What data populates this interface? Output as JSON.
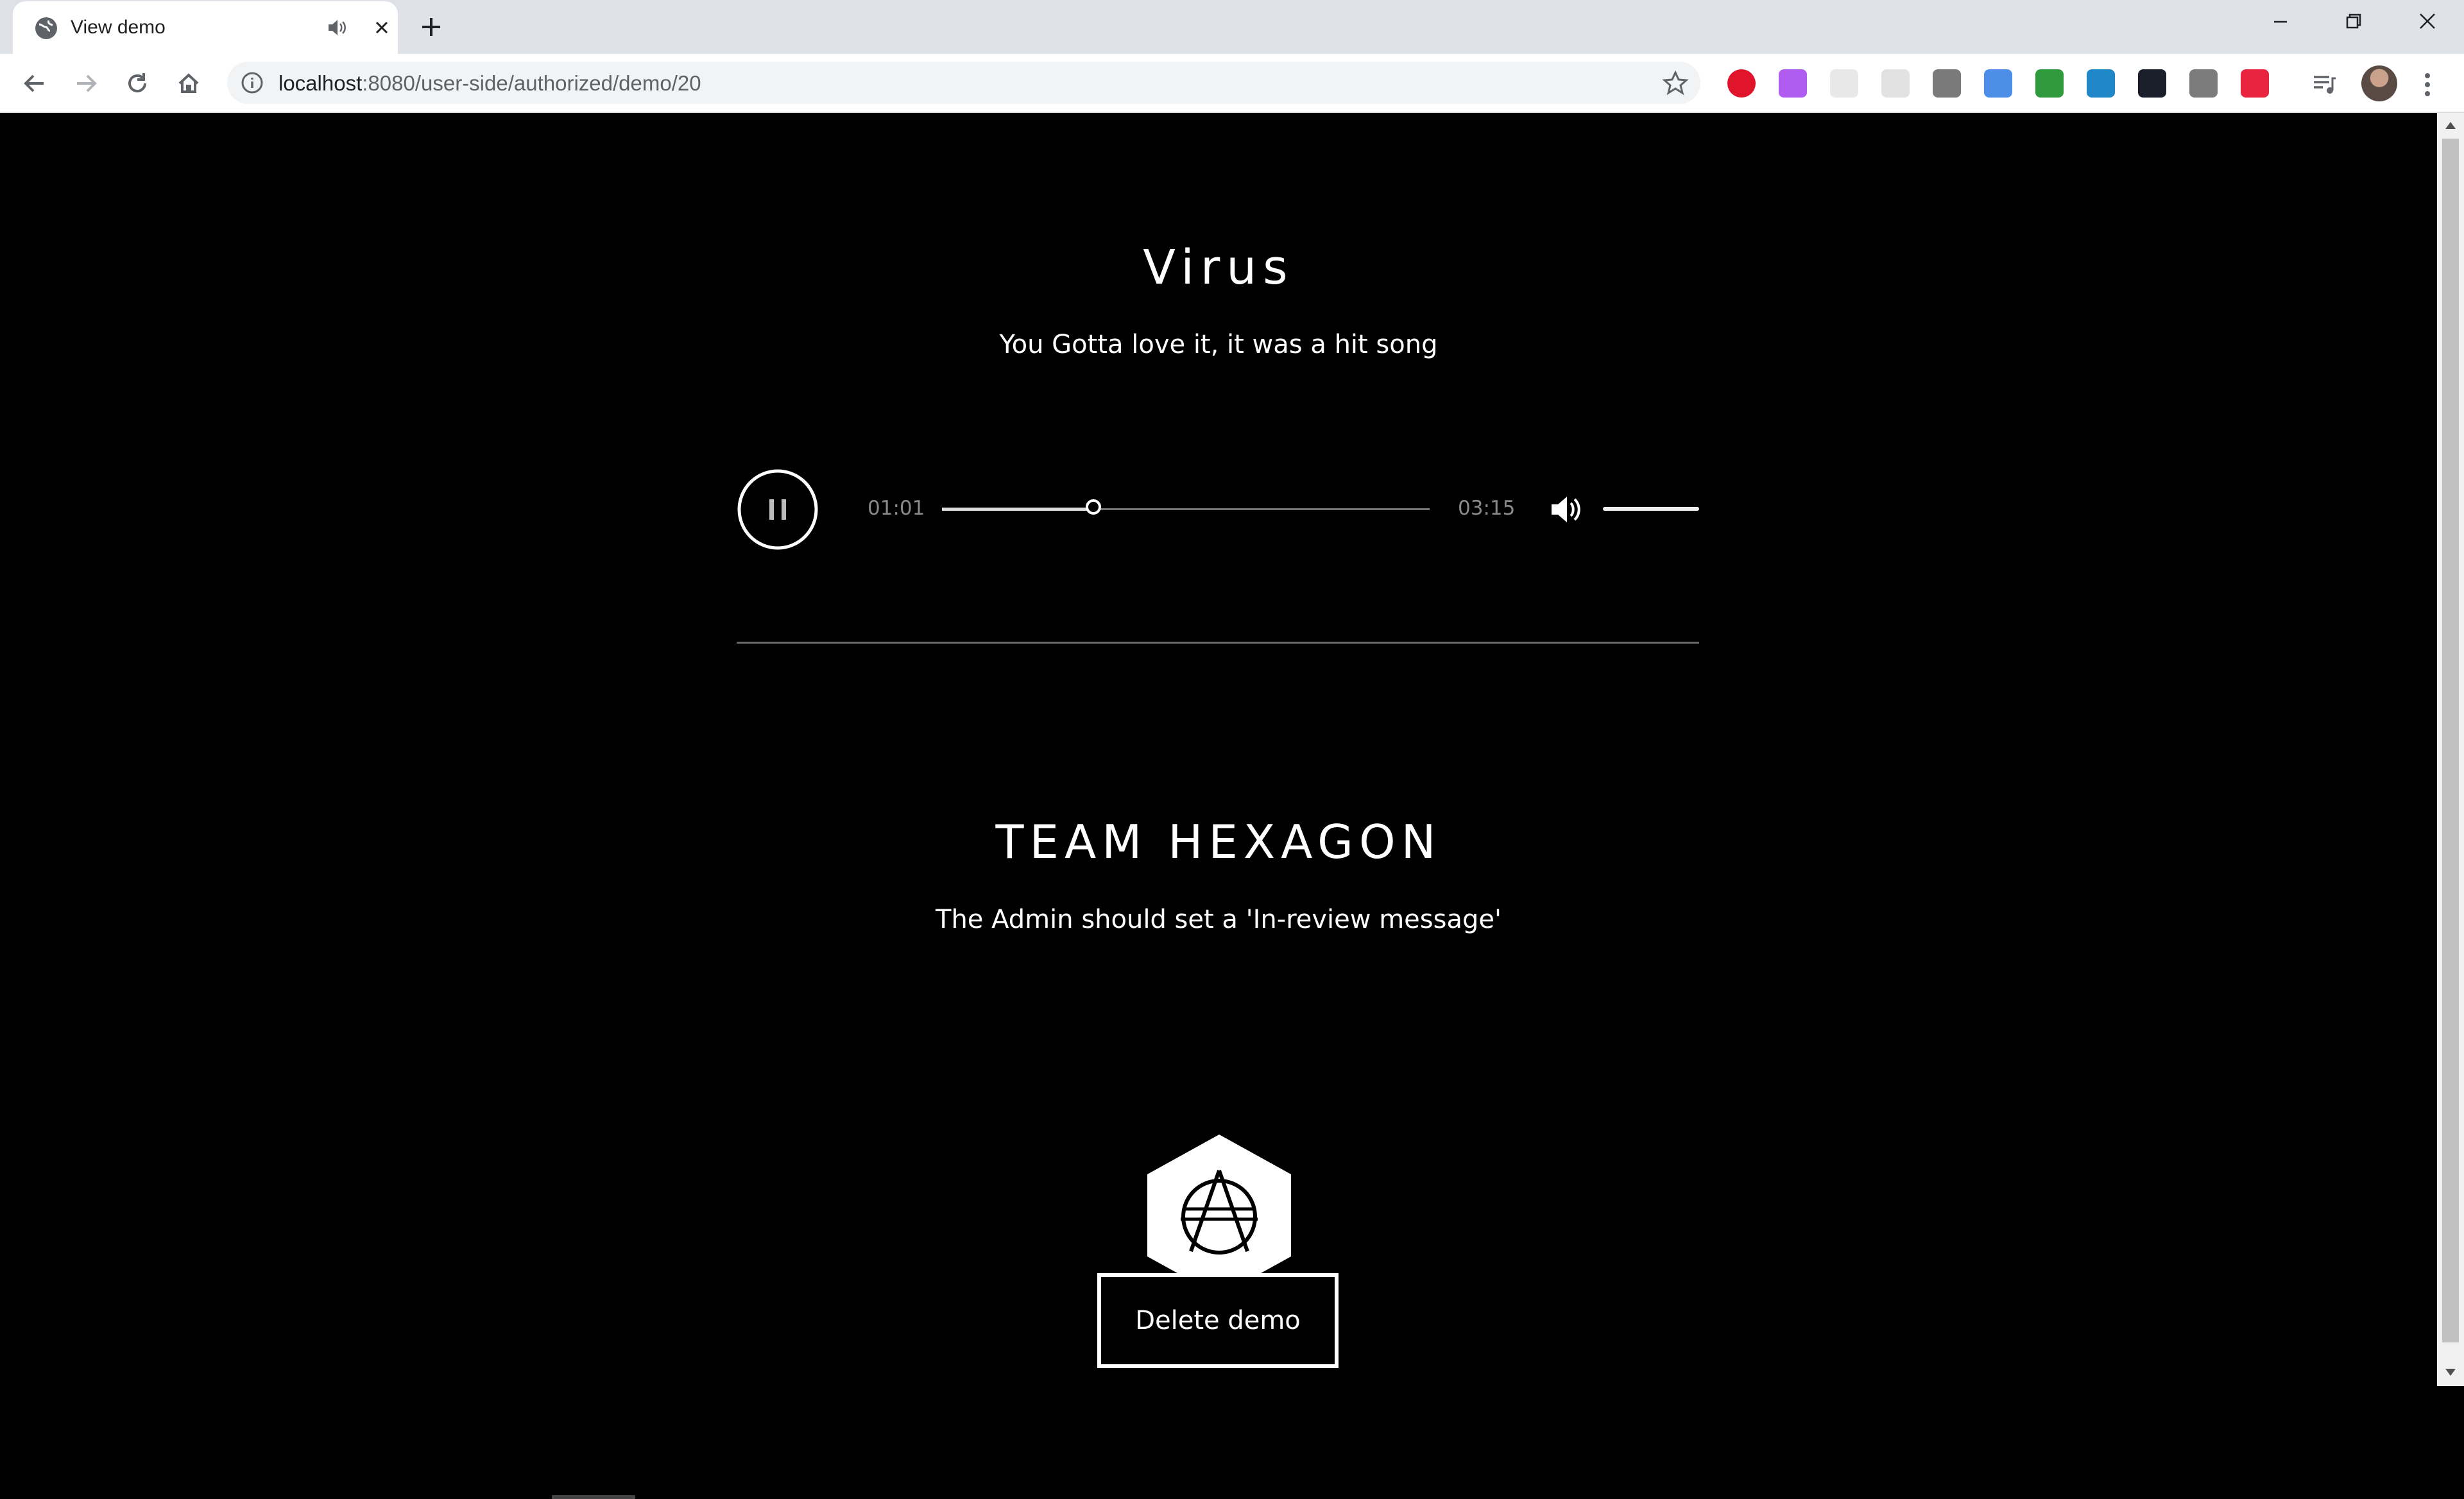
{
  "browser": {
    "tab": {
      "title": "View demo"
    },
    "url": {
      "host": "localhost",
      "rest": ":8080/user-side/authorized/demo/20"
    },
    "extensions": [
      {
        "name": "opera-icon",
        "color": "#e0142b"
      },
      {
        "name": "gradient-extension-icon",
        "color": "#b15cf0"
      },
      {
        "name": "calendar-extension-icon",
        "color": "#e8e8e8"
      },
      {
        "name": "grid-extension-icon",
        "color": "#e2e2e2"
      },
      {
        "name": "gear-extension-icon",
        "color": "#7a7a7a"
      },
      {
        "name": "blue-circle-extension-icon",
        "color": "#4d8ee8"
      },
      {
        "name": "green-figure-extension-icon",
        "color": "#2e9a3c"
      },
      {
        "name": "monitor-extension-icon",
        "color": "#1f86c8"
      },
      {
        "name": "x-extension-icon",
        "color": "#1a1f2b"
      },
      {
        "name": "s-extension-icon",
        "color": "#7b7b7b"
      },
      {
        "name": "play-flag-extension-icon",
        "color": "#e8243e"
      }
    ]
  },
  "demo": {
    "title": "Virus",
    "description": "You Gotta love it, it was a hit song"
  },
  "player": {
    "current_time": "01:01",
    "duration": "03:15",
    "progress_fraction": 0.31,
    "volume_fraction": 1.0,
    "state": "playing"
  },
  "team": {
    "name": "TEAM HEXAGON",
    "message": "The Admin should set a 'In-review message'"
  },
  "actions": {
    "delete_label": "Delete demo"
  }
}
